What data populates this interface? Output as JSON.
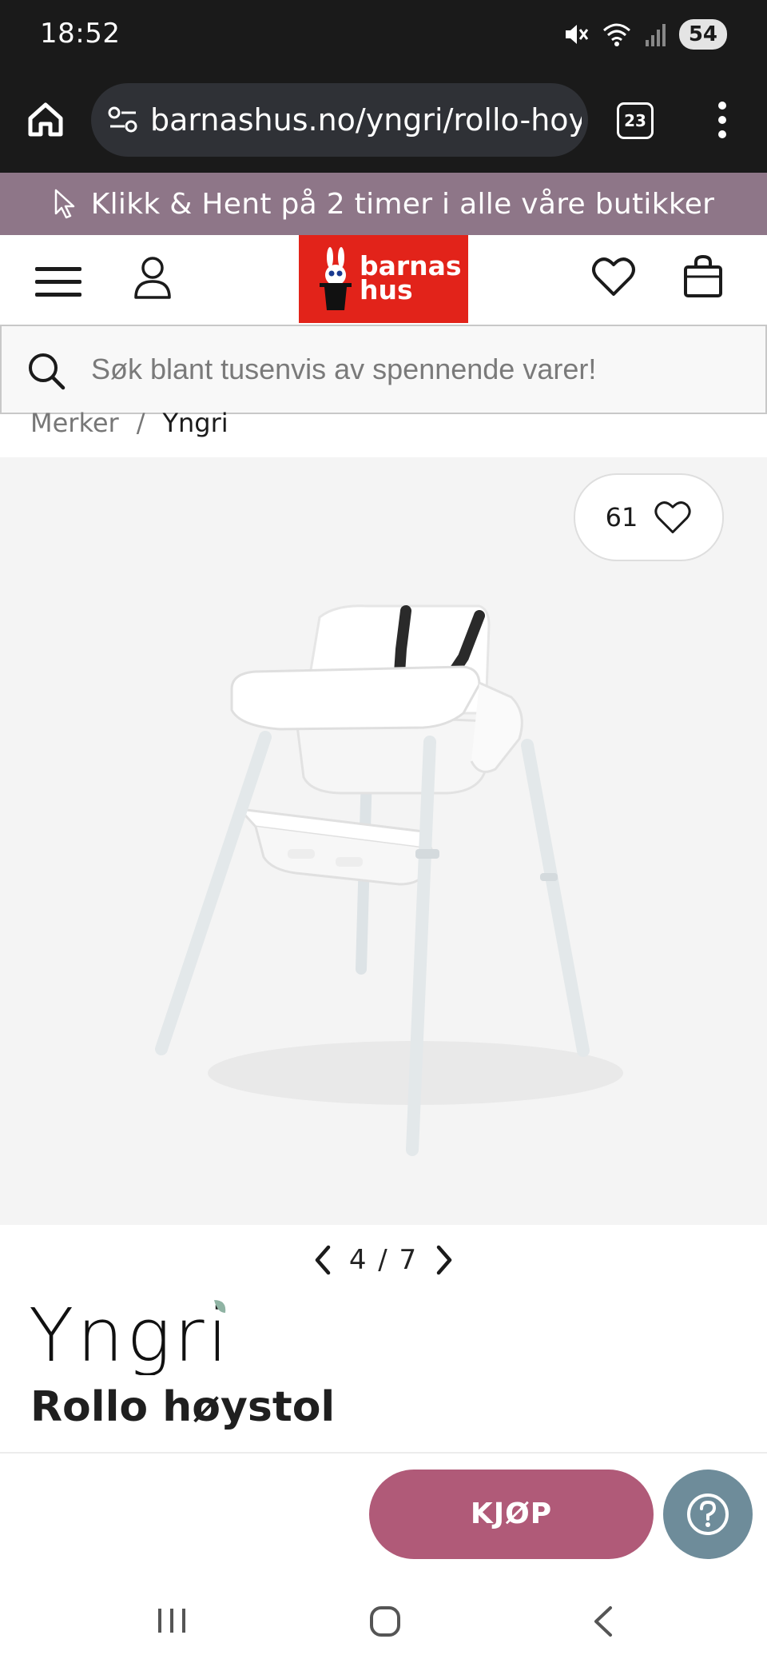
{
  "status_bar": {
    "time": "18:52",
    "battery": "54",
    "icons": [
      "mute-icon",
      "wifi-icon",
      "signal-icon",
      "battery-icon"
    ]
  },
  "browser": {
    "url": "barnashus.no/yngri/rollo-hoystol",
    "tab_count": "23",
    "icons": [
      "home-icon",
      "site-settings-icon",
      "menu-dots-icon"
    ]
  },
  "promo": {
    "text": "Klikk & Hent på 2 timer i alle våre butikker",
    "icon": "cursor-icon"
  },
  "header": {
    "logo_line1": "barnas",
    "logo_line2": "hus",
    "icons": [
      "hamburger-icon",
      "account-icon",
      "wishlist-icon",
      "cart-icon"
    ]
  },
  "search": {
    "placeholder": "Søk blant tusenvis av spennende varer!"
  },
  "breadcrumb": {
    "items": [
      "Merker",
      "Yngri"
    ],
    "separator": "/"
  },
  "gallery": {
    "like_count": "61",
    "current": "4",
    "total": "7",
    "pager_text": "4 / 7"
  },
  "product": {
    "brand": "Yngri",
    "title": "Rollo høystol"
  },
  "actions": {
    "buy_label": "KJØP",
    "help_icon": "help-icon"
  },
  "colors": {
    "promo_bg": "#8e7688",
    "logo_red": "#e2231a",
    "buy_button": "#b05a78",
    "help_button": "#6e8c9a",
    "status_bg": "#1a1a1a"
  }
}
